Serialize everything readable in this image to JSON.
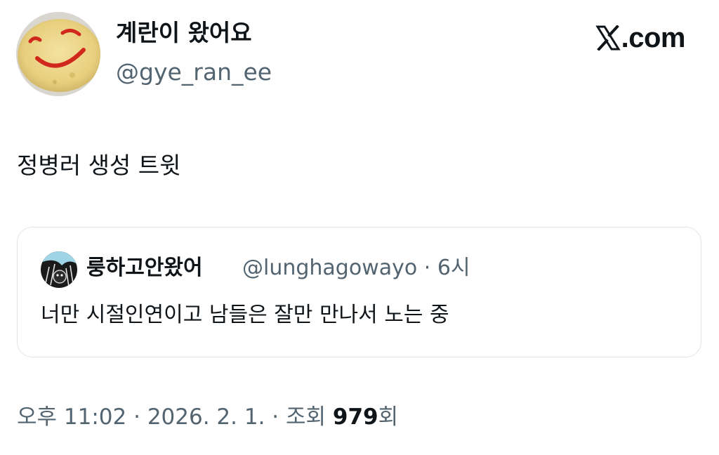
{
  "author": {
    "display_name": "계란이 왔어요",
    "handle": "@gye_ran_ee"
  },
  "brand": {
    "icon": "x-logo-icon",
    "suffix": ".com"
  },
  "tweet": {
    "text": "정병러 생성 트윗"
  },
  "quoted_tweet": {
    "display_name": "룽하고안왔어",
    "handle": "@lunghagowayo",
    "separator": "·",
    "time_ago": "6시",
    "text": "너만 시절인연이고 남들은 잘만 만나서 노는 중"
  },
  "footer": {
    "time": "오후 11:02",
    "sep1": "·",
    "date": "2026. 2. 1.",
    "sep2": "·",
    "views_label": "조회",
    "views_count": "979",
    "views_suffix": "회"
  },
  "colors": {
    "text_primary": "#0f1419",
    "text_secondary": "#536471",
    "card_border": "#dfe4e8",
    "background": "#ffffff"
  }
}
